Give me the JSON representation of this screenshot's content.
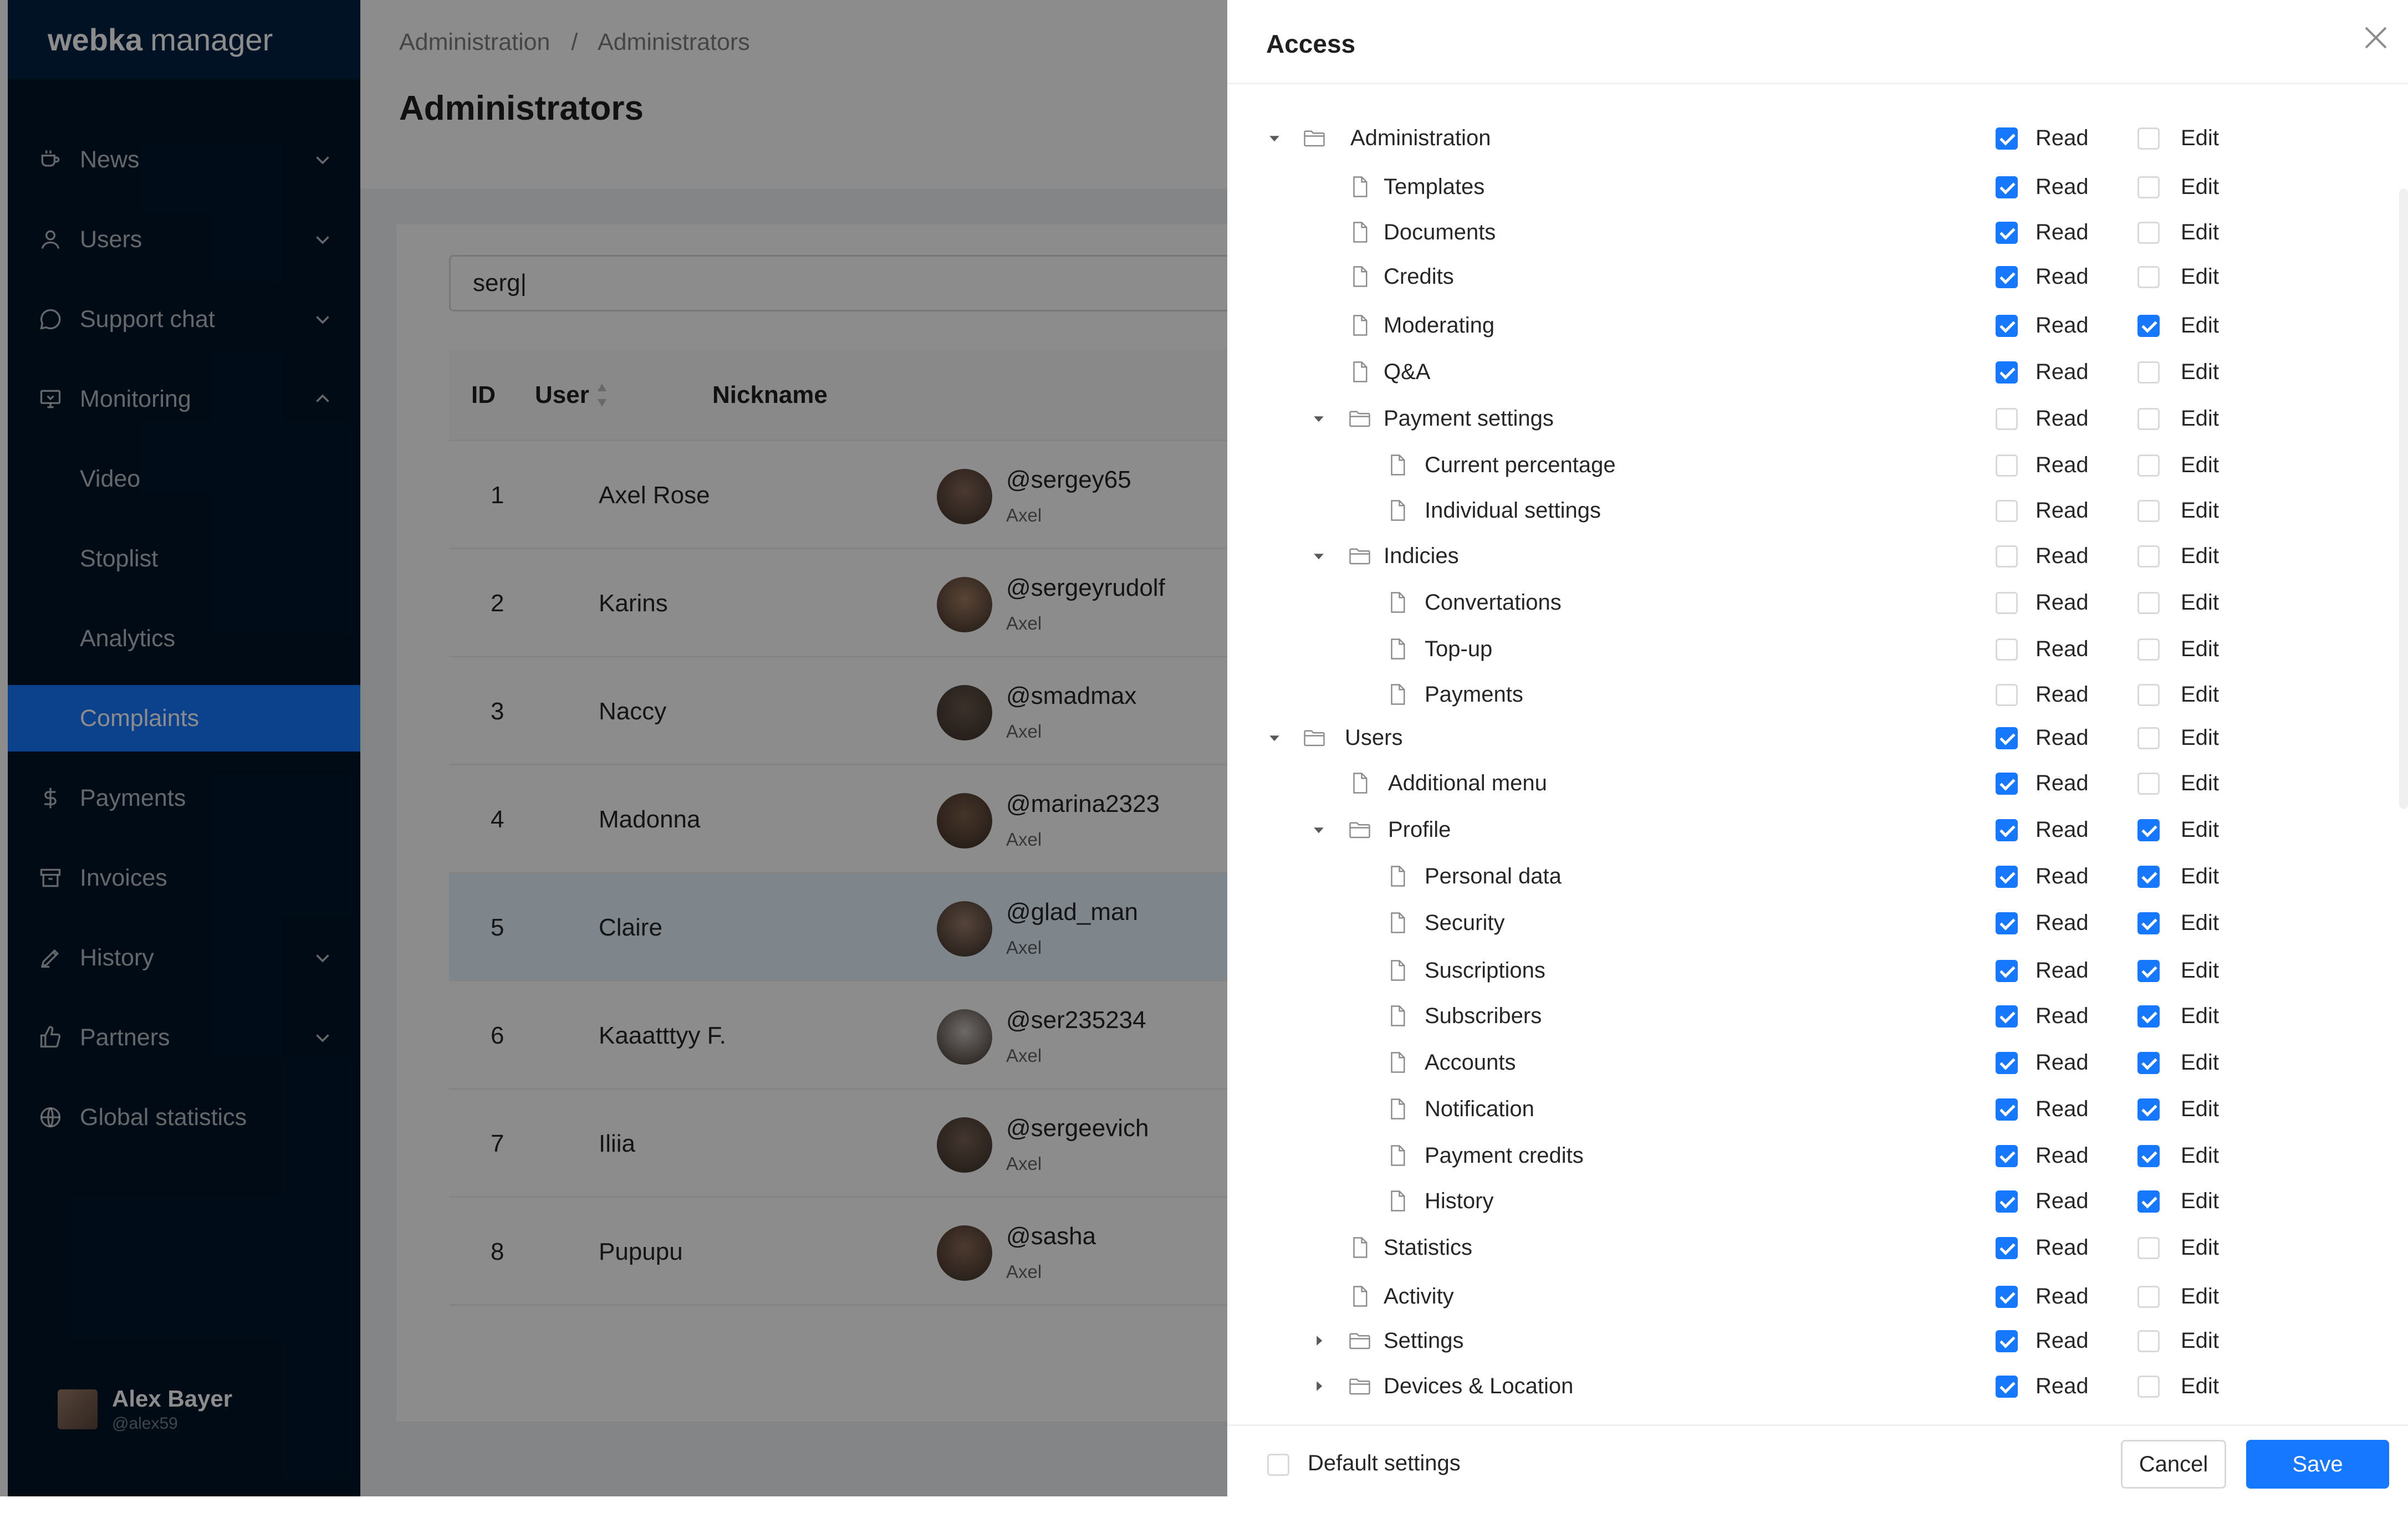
{
  "brand": {
    "bold": "webka",
    "rest": "manager"
  },
  "nav": [
    {
      "label": "News",
      "icon": "cup-icon",
      "chevron": "down",
      "active": false
    },
    {
      "label": "Users",
      "icon": "user-icon",
      "chevron": "down",
      "active": false
    },
    {
      "label": "Support chat",
      "icon": "chat-icon",
      "chevron": "down",
      "active": false
    },
    {
      "label": "Monitoring",
      "icon": "monitor-icon",
      "chevron": "up",
      "active": false
    },
    {
      "label": "Video",
      "icon": "",
      "chevron": "",
      "active": false
    },
    {
      "label": "Stoplist",
      "icon": "",
      "chevron": "",
      "active": false
    },
    {
      "label": "Analytics",
      "icon": "",
      "chevron": "",
      "active": false
    },
    {
      "label": "Complaints",
      "icon": "",
      "chevron": "",
      "active": true
    },
    {
      "label": "Payments",
      "icon": "dollar-icon",
      "chevron": "",
      "active": false
    },
    {
      "label": "Invoices",
      "icon": "archive-icon",
      "chevron": "",
      "active": false
    },
    {
      "label": "History",
      "icon": "pen-icon",
      "chevron": "down",
      "active": false
    },
    {
      "label": "Partners",
      "icon": "like-icon",
      "chevron": "down",
      "active": false
    },
    {
      "label": "Global statistics",
      "icon": "globe-icon",
      "chevron": "",
      "active": false
    }
  ],
  "current_user": {
    "name": "Alex Bayer",
    "handle": "@alex59"
  },
  "breadcrumb": [
    "Administration",
    "/",
    "Administrators"
  ],
  "page_title": "Administrators",
  "search": {
    "value": "serg|"
  },
  "table": {
    "headers": {
      "id": "ID",
      "user": "User",
      "nickname": "Nickname"
    },
    "rows": [
      {
        "id": "1",
        "user": "Axel Rose",
        "nick": "@sergey65",
        "sub": "Axel",
        "selected": false
      },
      {
        "id": "2",
        "user": "Karins",
        "nick": "@sergeyrudolf",
        "sub": "Axel",
        "selected": false
      },
      {
        "id": "3",
        "user": "Naccy",
        "nick": "@smadmax",
        "sub": "Axel",
        "selected": false
      },
      {
        "id": "4",
        "user": "Madonna",
        "nick": "@marina2323",
        "sub": "Axel",
        "selected": false
      },
      {
        "id": "5",
        "user": "Claire",
        "nick": "@glad_man",
        "sub": "Axel",
        "selected": true
      },
      {
        "id": "6",
        "user": "Kaaatttyy F.",
        "nick": "@ser235234",
        "sub": "Axel",
        "selected": false
      },
      {
        "id": "7",
        "user": "Iliia",
        "nick": "@sergeevich",
        "sub": "Axel",
        "selected": false
      },
      {
        "id": "8",
        "user": "Pupupu",
        "nick": "@sasha",
        "sub": "Axel",
        "selected": false
      }
    ]
  },
  "drawer": {
    "title": "Access",
    "read_label": "Read",
    "edit_label": "Edit",
    "default_label": "Default settings",
    "cancel_label": "Cancel",
    "save_label": "Save",
    "tree": [
      {
        "label": "Administration",
        "level": 0,
        "type": "folder",
        "switcher": "open",
        "read": true,
        "edit": false
      },
      {
        "label": "Templates",
        "level": 1,
        "type": "file",
        "switcher": "",
        "read": true,
        "edit": false
      },
      {
        "label": "Documents",
        "level": 1,
        "type": "file",
        "switcher": "",
        "read": true,
        "edit": false
      },
      {
        "label": "Credits",
        "level": 1,
        "type": "file",
        "switcher": "",
        "read": true,
        "edit": false
      },
      {
        "label": "Moderating",
        "level": 1,
        "type": "file",
        "switcher": "",
        "read": true,
        "edit": true
      },
      {
        "label": "Q&A",
        "level": 1,
        "type": "file",
        "switcher": "",
        "read": true,
        "edit": false
      },
      {
        "label": "Payment settings",
        "level": 1,
        "type": "folder",
        "switcher": "open",
        "read": false,
        "edit": false
      },
      {
        "label": "Current percentage",
        "level": 2,
        "type": "file",
        "switcher": "",
        "read": false,
        "edit": false
      },
      {
        "label": "Individual settings",
        "level": 2,
        "type": "file",
        "switcher": "",
        "read": false,
        "edit": false
      },
      {
        "label": "Indicies",
        "level": 1,
        "type": "folder",
        "switcher": "open",
        "read": false,
        "edit": false
      },
      {
        "label": "Convertations",
        "level": 2,
        "type": "file",
        "switcher": "",
        "read": false,
        "edit": false
      },
      {
        "label": "Top-up",
        "level": 2,
        "type": "file",
        "switcher": "",
        "read": false,
        "edit": false
      },
      {
        "label": "Payments",
        "level": 2,
        "type": "file",
        "switcher": "",
        "read": false,
        "edit": false
      },
      {
        "label": "Users",
        "level": 0,
        "type": "folder",
        "switcher": "open",
        "read": true,
        "edit": false
      },
      {
        "label": "Additional menu",
        "level": 1,
        "type": "file",
        "switcher": "",
        "read": true,
        "edit": false
      },
      {
        "label": "Profile",
        "level": 1,
        "type": "folder",
        "switcher": "open",
        "read": true,
        "edit": true
      },
      {
        "label": "Personal data",
        "level": 2,
        "type": "file",
        "switcher": "",
        "read": true,
        "edit": true
      },
      {
        "label": "Security",
        "level": 2,
        "type": "file",
        "switcher": "",
        "read": true,
        "edit": true
      },
      {
        "label": "Suscriptions",
        "level": 2,
        "type": "file",
        "switcher": "",
        "read": true,
        "edit": true
      },
      {
        "label": "Subscribers",
        "level": 2,
        "type": "file",
        "switcher": "",
        "read": true,
        "edit": true
      },
      {
        "label": "Accounts",
        "level": 2,
        "type": "file",
        "switcher": "",
        "read": true,
        "edit": true
      },
      {
        "label": "Notification",
        "level": 2,
        "type": "file",
        "switcher": "",
        "read": true,
        "edit": true
      },
      {
        "label": "Payment credits",
        "level": 2,
        "type": "file",
        "switcher": "",
        "read": true,
        "edit": true
      },
      {
        "label": "History",
        "level": 2,
        "type": "file",
        "switcher": "",
        "read": true,
        "edit": true
      },
      {
        "label": "Statistics",
        "level": 1,
        "type": "file",
        "switcher": "",
        "read": true,
        "edit": false
      },
      {
        "label": "Activity",
        "level": 1,
        "type": "file",
        "switcher": "",
        "read": true,
        "edit": false
      },
      {
        "label": "Settings",
        "level": 1,
        "type": "folder",
        "switcher": "closed",
        "read": true,
        "edit": false
      },
      {
        "label": "Devices & Location",
        "level": 1,
        "type": "folder",
        "switcher": "closed",
        "read": true,
        "edit": false
      }
    ]
  },
  "colors": {
    "sidebar": "#001529",
    "accent": "#1677ff",
    "selected_row": "#e6f4ff"
  }
}
